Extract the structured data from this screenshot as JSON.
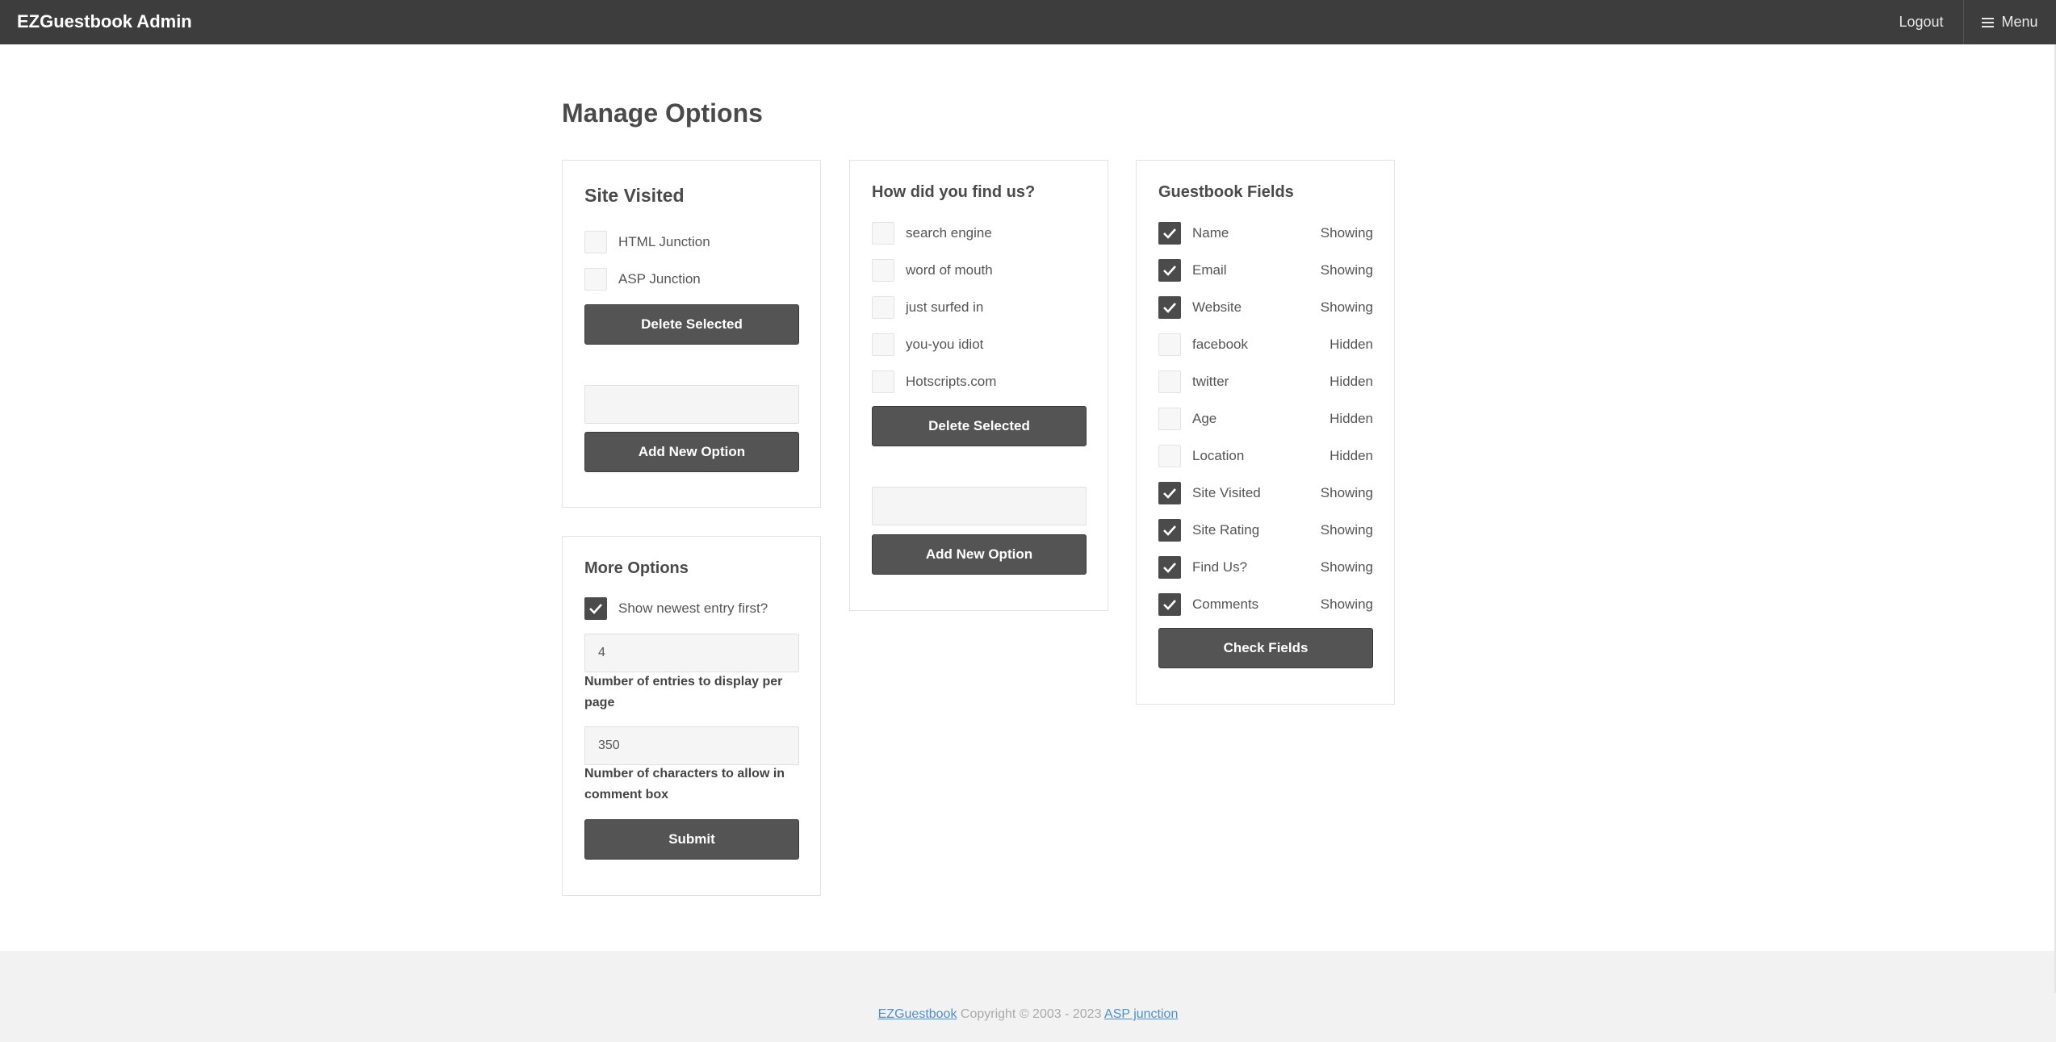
{
  "app": {
    "title": "EZGuestbook Admin",
    "logout": "Logout",
    "menu": "Menu"
  },
  "page": {
    "title": "Manage Options"
  },
  "site_visited": {
    "title": "Site Visited",
    "options": [
      {
        "label": "HTML Junction",
        "checked": false
      },
      {
        "label": "ASP Junction",
        "checked": false
      }
    ],
    "delete_label": "Delete Selected",
    "new_option_value": "",
    "add_label": "Add New Option"
  },
  "find_us": {
    "title": "How did you find us?",
    "options": [
      {
        "label": "search engine",
        "checked": false
      },
      {
        "label": "word of mouth",
        "checked": false
      },
      {
        "label": "just surfed in",
        "checked": false
      },
      {
        "label": "you-you idiot",
        "checked": false
      },
      {
        "label": "Hotscripts.com",
        "checked": false
      }
    ],
    "delete_label": "Delete Selected",
    "new_option_value": "",
    "add_label": "Add New Option"
  },
  "guestbook_fields": {
    "title": "Guestbook Fields",
    "fields": [
      {
        "label": "Name",
        "status": "Showing",
        "checked": true
      },
      {
        "label": "Email",
        "status": "Showing",
        "checked": true
      },
      {
        "label": "Website",
        "status": "Showing",
        "checked": true
      },
      {
        "label": "facebook",
        "status": "Hidden",
        "checked": false
      },
      {
        "label": "twitter",
        "status": "Hidden",
        "checked": false
      },
      {
        "label": "Age",
        "status": "Hidden",
        "checked": false
      },
      {
        "label": "Location",
        "status": "Hidden",
        "checked": false
      },
      {
        "label": "Site Visited",
        "status": "Showing",
        "checked": true
      },
      {
        "label": "Site Rating",
        "status": "Showing",
        "checked": true
      },
      {
        "label": "Find Us?",
        "status": "Showing",
        "checked": true
      },
      {
        "label": "Comments",
        "status": "Showing",
        "checked": true
      }
    ],
    "check_label": "Check Fields"
  },
  "more_options": {
    "title": "More Options",
    "newest_first_label": "Show newest entry first?",
    "newest_first_checked": true,
    "entries_per_page": "4",
    "entries_help": "Number of entries to display per page",
    "comment_chars": "350",
    "comment_help": "Number of characters to allow in comment box",
    "submit_label": "Submit"
  },
  "footer": {
    "brand_link": "EZGuestbook",
    "copyright": " Copyright © 2003 - 2023 ",
    "author_link": "ASP junction"
  },
  "colors": {
    "topbar": "#3d3d3d",
    "button": "#545454",
    "link": "#4b8fd1",
    "footer_bg": "#f2f2f2"
  }
}
